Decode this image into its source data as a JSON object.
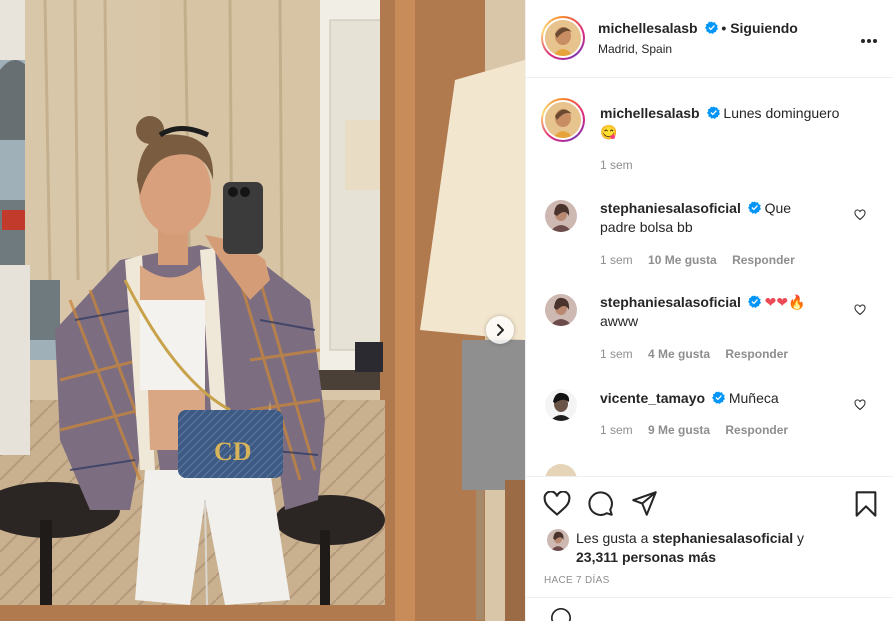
{
  "post": {
    "author": "michellesalasb",
    "follow_status": "• Siguiendo",
    "location": "Madrid, Spain",
    "caption": "Lunes dominguero",
    "caption_emoji": "😋",
    "caption_time": "1 sem"
  },
  "comments": [
    {
      "user": "stephaniesalasoficial",
      "text_line1": "Que",
      "text_line2": "padre bolsa bb",
      "time": "1 sem",
      "likes": "10 Me gusta",
      "reply": "Responder"
    },
    {
      "user": "stephaniesalasoficial",
      "emoji": "❤❤🔥",
      "text_line2": "awww",
      "time": "1 sem",
      "likes": "4 Me gusta",
      "reply": "Responder"
    },
    {
      "user": "vicente_tamayo",
      "text_line1": "Muñeca",
      "time": "1 sem",
      "likes": "9 Me gusta",
      "reply": "Responder"
    }
  ],
  "likes_summary": {
    "prefix": "Les gusta a",
    "user": "stephaniesalasoficial",
    "suffix": "y",
    "others": "23,311 personas más"
  },
  "date": "HACE 7 DÍAS",
  "icons": [
    "heart-icon",
    "comment-icon",
    "share-icon",
    "bookmark-icon",
    "more-icon",
    "chevron-right-icon",
    "verified-icon"
  ],
  "colors": {
    "accent": "#0095f6",
    "text": "#262626",
    "muted": "#8e8e8e",
    "border": "#efefef",
    "heart_red": "#ed4956"
  }
}
